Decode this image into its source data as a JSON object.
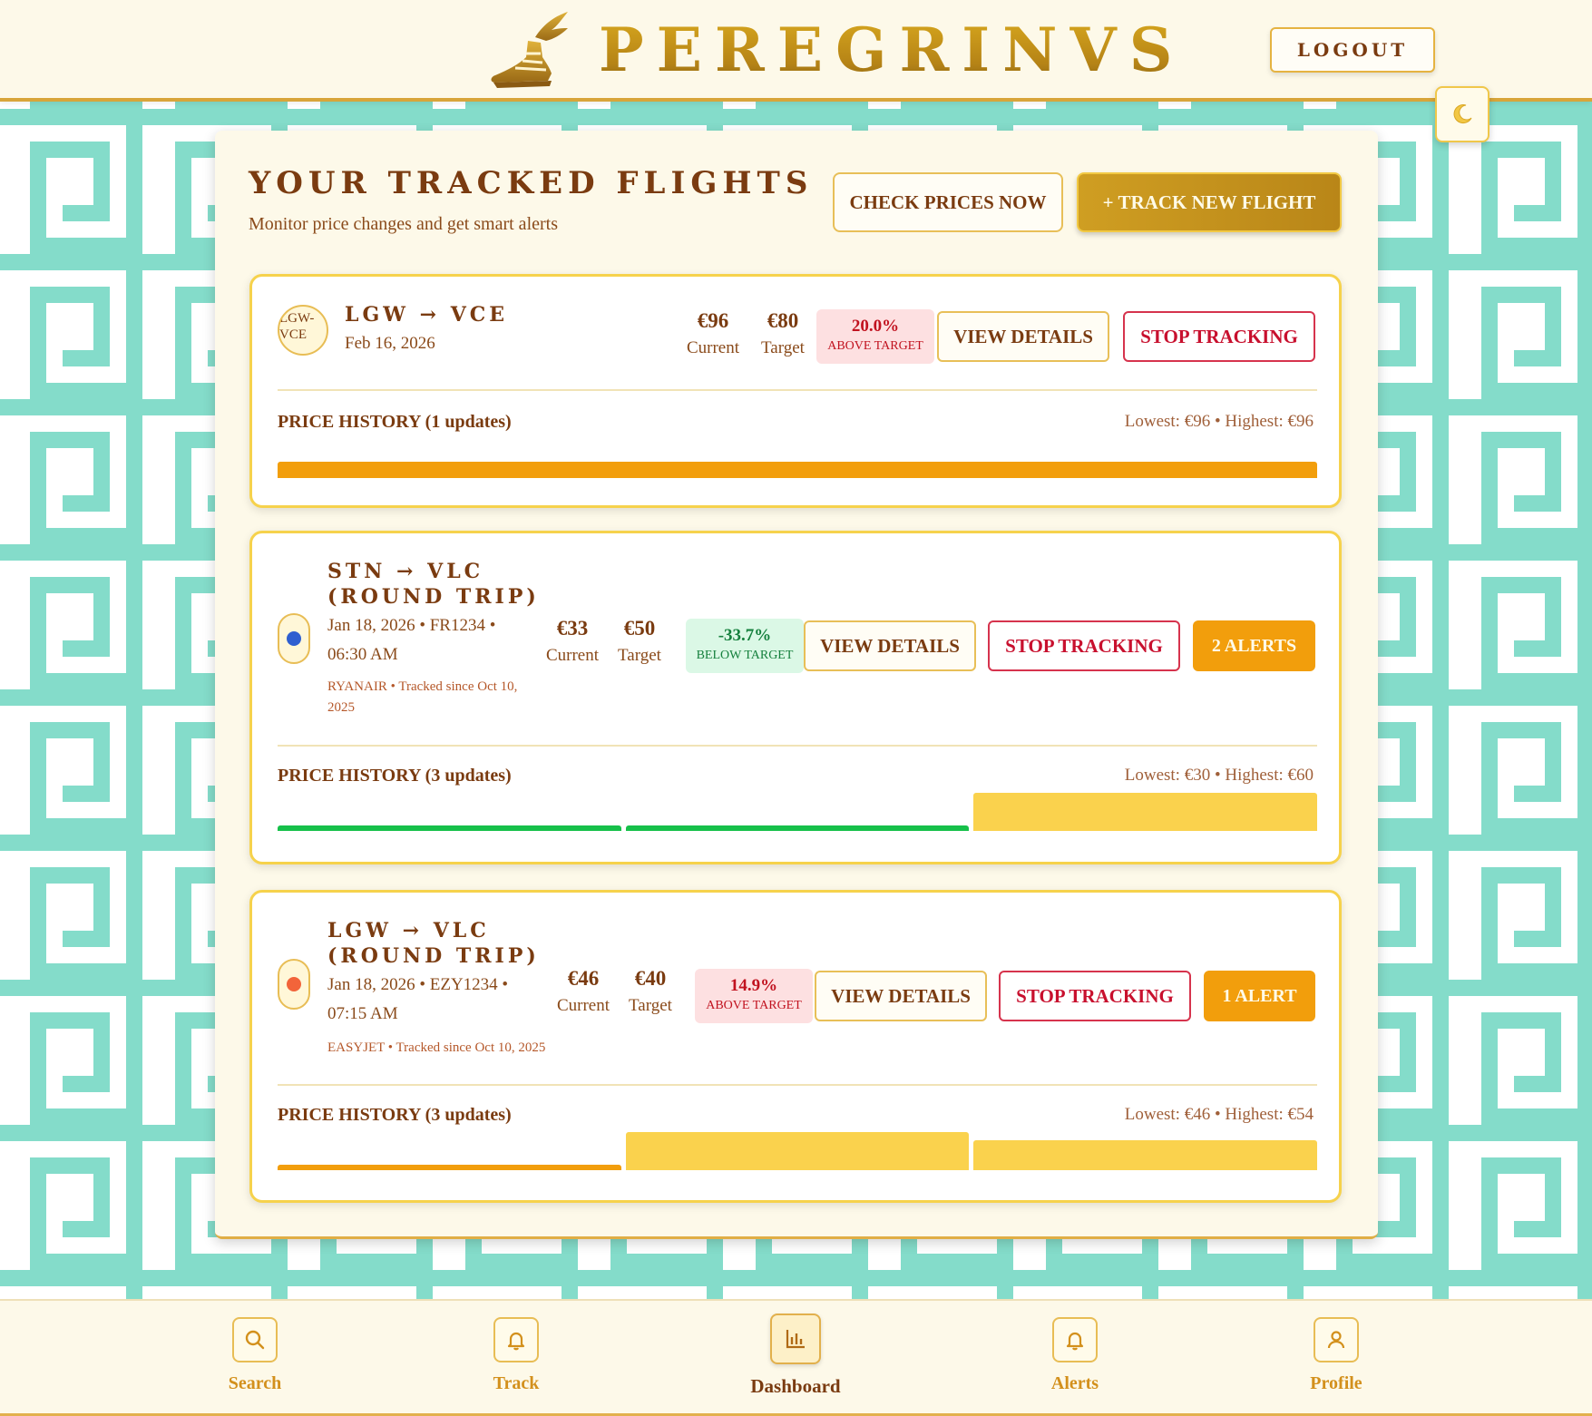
{
  "app": {
    "brand": "PEREGRINVS",
    "logout_label": "LOGOUT",
    "theme_icon": "moon-icon"
  },
  "page": {
    "title": "YOUR TRACKED FLIGHTS",
    "subtitle": "Monitor price changes and get smart alerts",
    "check_prices_label": "CHECK PRICES NOW",
    "track_new_label": "+ TRACK NEW FLIGHT"
  },
  "flights": [
    {
      "badge": "LGW-VCE",
      "route": "LGW → VCE",
      "date": "Feb 16, 2026",
      "current": "€96",
      "current_label": "Current",
      "target": "€80",
      "target_label": "Target",
      "delta_pct": "20.0%",
      "delta_label": "ABOVE TARGET",
      "view_label": "VIEW DETAILS",
      "stop_label": "STOP TRACKING",
      "history_title": "PRICE HISTORY (1 updates)",
      "history_range": "Lowest: €96 • Highest: €96",
      "history": [
        96
      ]
    },
    {
      "route_line1": "STN → VLC",
      "route_line2": "(ROUND TRIP)",
      "details_line1": "Jan 18, 2026 • FR1234 •",
      "details_line2": "06:30 AM",
      "airline_line1": "RYANAIR • Tracked since Oct 10,",
      "airline_line2": "2025",
      "dot_color": "#2f5fd0",
      "current": "€33",
      "current_label": "Current",
      "target": "€50",
      "target_label": "Target",
      "delta_pct": "-33.7%",
      "delta_label": "BELOW TARGET",
      "view_label": "VIEW DETAILS",
      "stop_label": "STOP TRACKING",
      "alerts_label": "2 ALERTS",
      "history_title": "PRICE HISTORY (3 updates)",
      "history_range": "Lowest: €30 • Highest: €60",
      "history": [
        30,
        30,
        60
      ]
    },
    {
      "route_line1": "LGW → VLC",
      "route_line2": "(ROUND TRIP)",
      "details_line1": "Jan 18, 2026 • EZY1234 •",
      "details_line2": "07:15 AM",
      "airline_line1": "EASYJET • Tracked since Oct 10, 2025",
      "dot_color": "#f2643a",
      "current": "€46",
      "current_label": "Current",
      "target": "€40",
      "target_label": "Target",
      "delta_pct": "14.9%",
      "delta_label": "ABOVE TARGET",
      "view_label": "VIEW DETAILS",
      "stop_label": "STOP TRACKING",
      "alerts_label": "1 ALERT",
      "history_title": "PRICE HISTORY (3 updates)",
      "history_range": "Lowest: €46 • Highest: €54",
      "history": [
        46,
        54,
        52
      ]
    }
  ],
  "nav": {
    "items": [
      {
        "label": "Search",
        "icon": "search-icon"
      },
      {
        "label": "Track",
        "icon": "bell-icon"
      },
      {
        "label": "Dashboard",
        "icon": "bar-chart-icon",
        "active": true
      },
      {
        "label": "Alerts",
        "icon": "bell-icon"
      },
      {
        "label": "Profile",
        "icon": "user-icon"
      }
    ]
  },
  "colors": {
    "accent_gold": "#c09220",
    "text_brown": "#7a3b10",
    "alert_orange": "#f29e0c",
    "stop_red": "#c8102e",
    "below_green": "#15803d",
    "pattern_teal": "#84dcca"
  }
}
